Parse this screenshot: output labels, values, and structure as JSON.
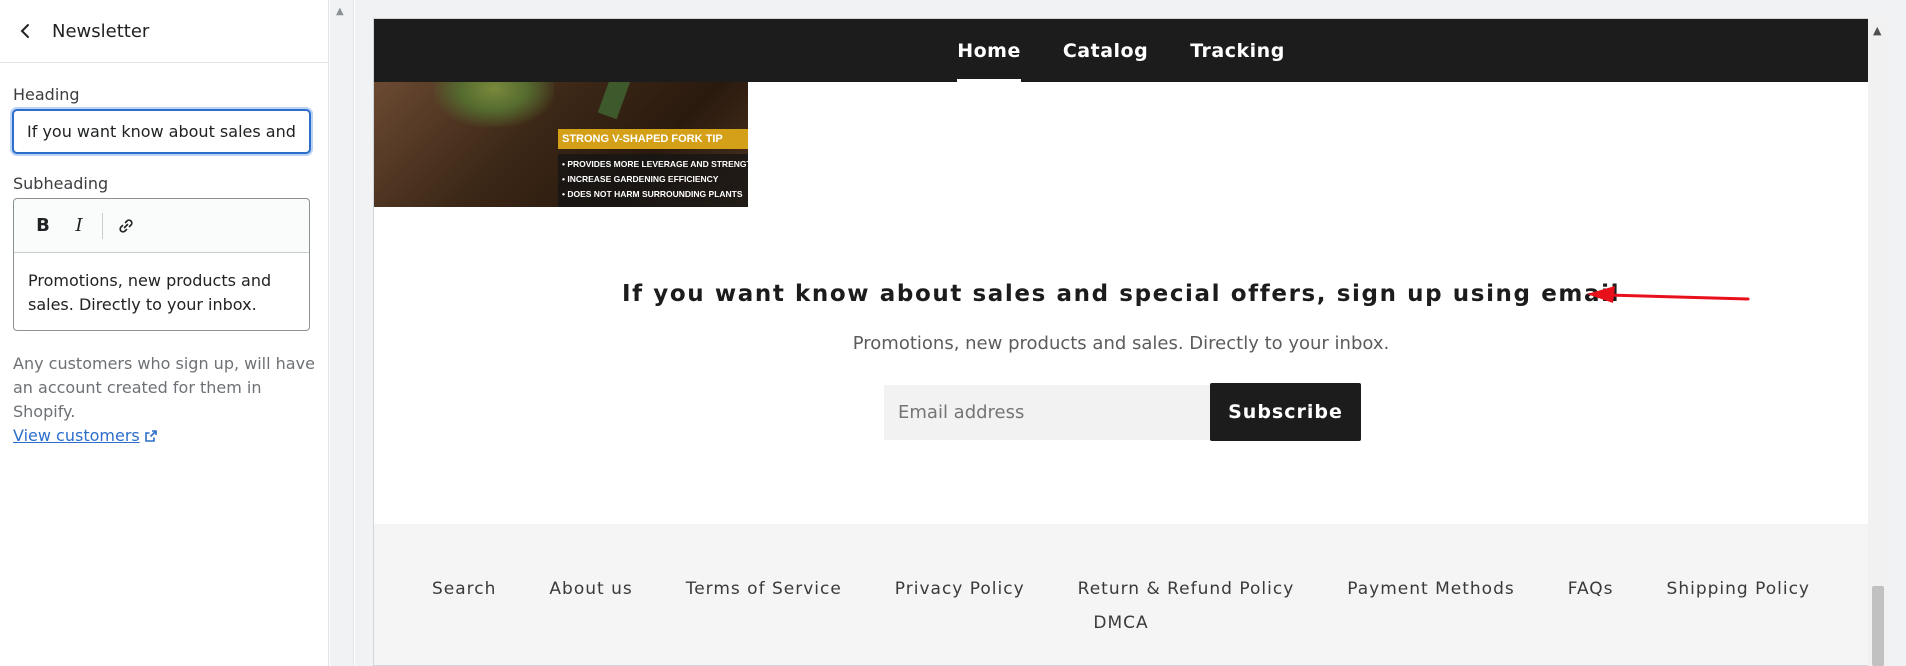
{
  "panel": {
    "title": "Newsletter",
    "heading_label": "Heading",
    "heading_value": "If you want know about sales and special offers, sign up using email",
    "subheading_label": "Subheading",
    "toolbar": {
      "bold": "B",
      "italic": "I"
    },
    "subheading_value": "Promotions, new products and sales. Directly to your inbox.",
    "help_text": "Any customers who sign up, will have an account created for them in Shopify.",
    "help_link": "View customers"
  },
  "store": {
    "nav": [
      "Home",
      "Catalog",
      "Tracking"
    ],
    "promo": {
      "banner": "STRONG V-SHAPED FORK TIP",
      "bullets": [
        "• Provides more leverage and strength",
        "• Increase gardening efficiency",
        "• Does not harm surrounding plants"
      ]
    },
    "newsletter": {
      "heading": "If you want know about sales and special offers, sign up using email",
      "subheading": "Promotions, new products and sales. Directly to your inbox.",
      "email_placeholder": "Email address",
      "subscribe_label": "Subscribe"
    },
    "footer_links": [
      "Search",
      "About us",
      "Terms of Service",
      "Privacy Policy",
      "Return & Refund Policy",
      "Payment Methods",
      "FAQs",
      "Shipping Policy",
      "DMCA"
    ]
  },
  "colors": {
    "accent": "#2c6ecb",
    "store_nav_bg": "#1c1c1c",
    "annotation": "#e8101a"
  }
}
